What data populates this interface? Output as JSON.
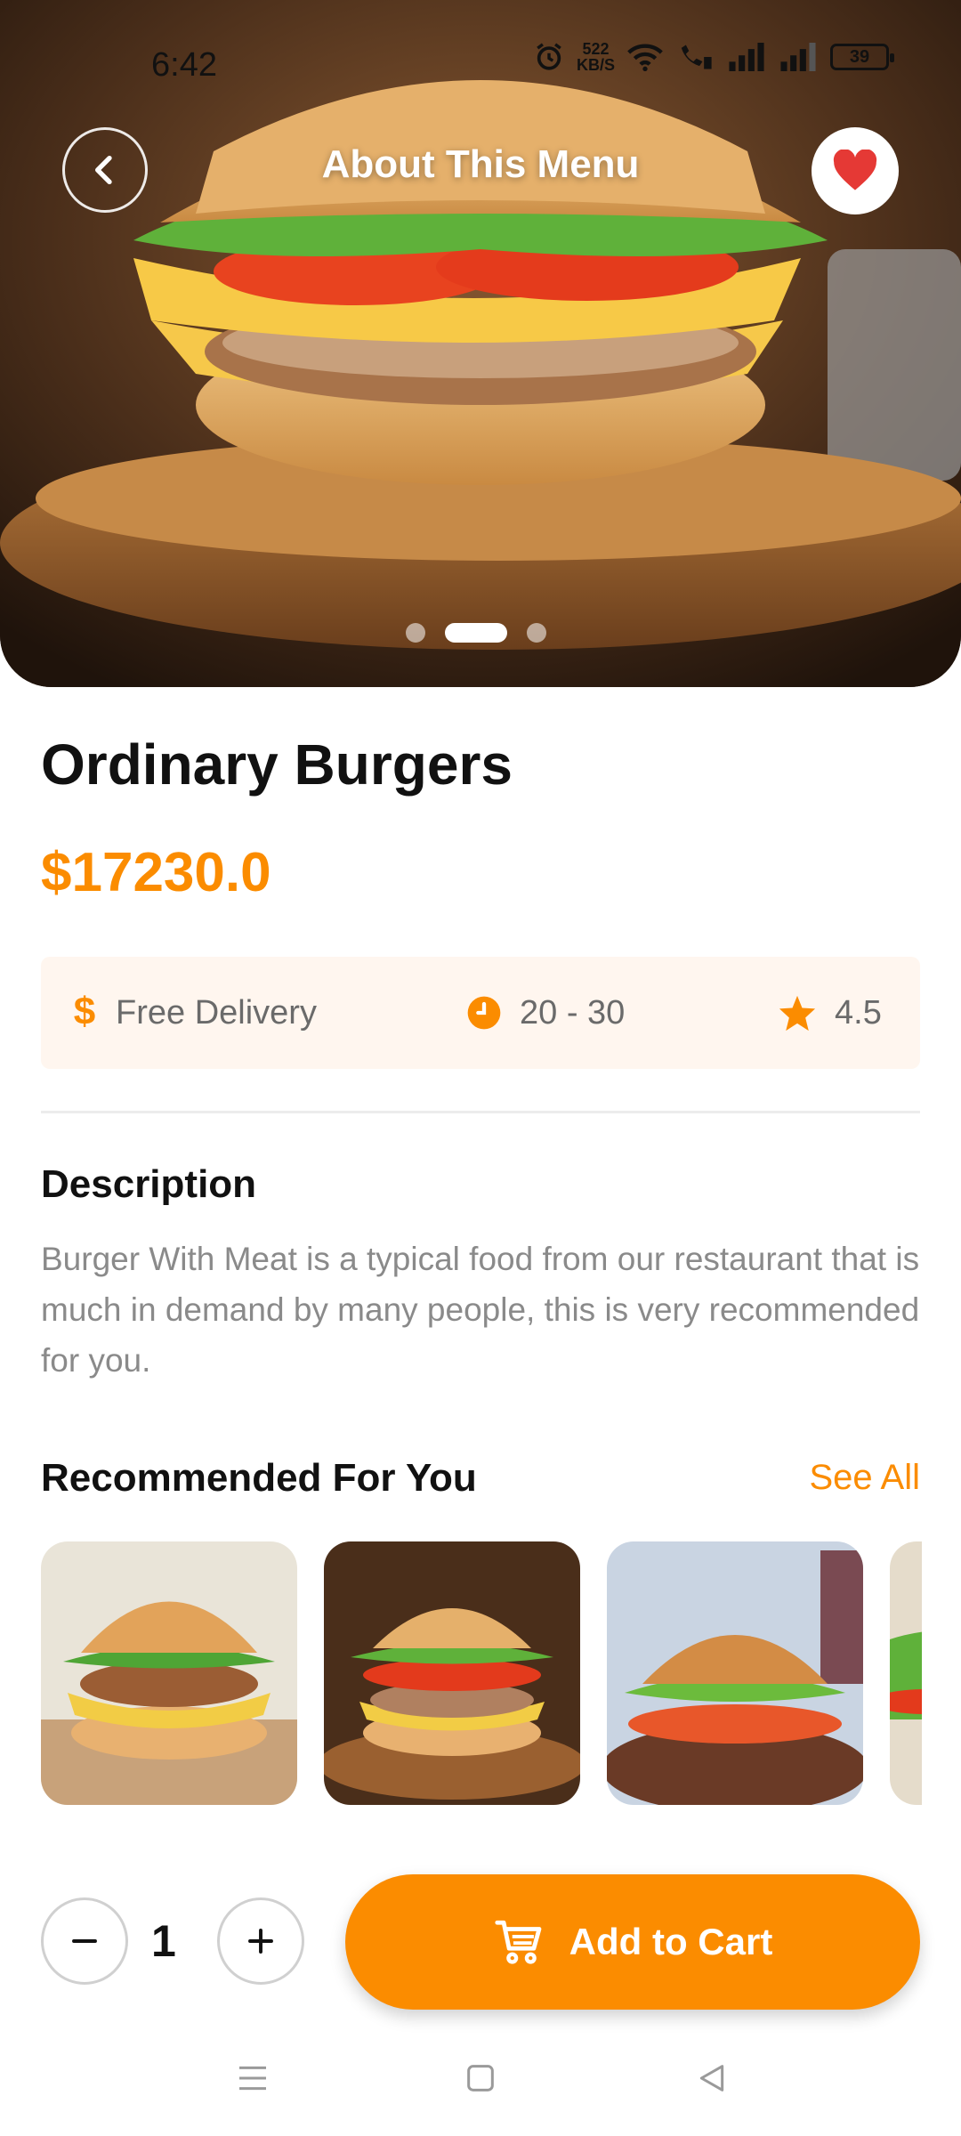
{
  "status_bar": {
    "time": "6:42",
    "net_speed": "522",
    "net_unit": "KB/S",
    "battery": "39"
  },
  "header": {
    "title": "About This Menu"
  },
  "carousel": {
    "total_slides": 3,
    "active_slide": 2
  },
  "product": {
    "name": "Ordinary Burgers",
    "price": "$17230.0",
    "delivery": "Free Delivery",
    "time": "20 - 30",
    "rating": "4.5"
  },
  "description": {
    "title": "Description",
    "text": "Burger With Meat is a typical food from our restaurant that is much in demand by many people, this is very recommended for you."
  },
  "recommended": {
    "title": "Recommended For You",
    "see_all": "See All"
  },
  "cart": {
    "quantity": "1",
    "add_label": "Add to Cart"
  },
  "colors": {
    "accent": "#fb8c00",
    "info_bg": "#fff6ef",
    "favorite": "#e53935"
  }
}
